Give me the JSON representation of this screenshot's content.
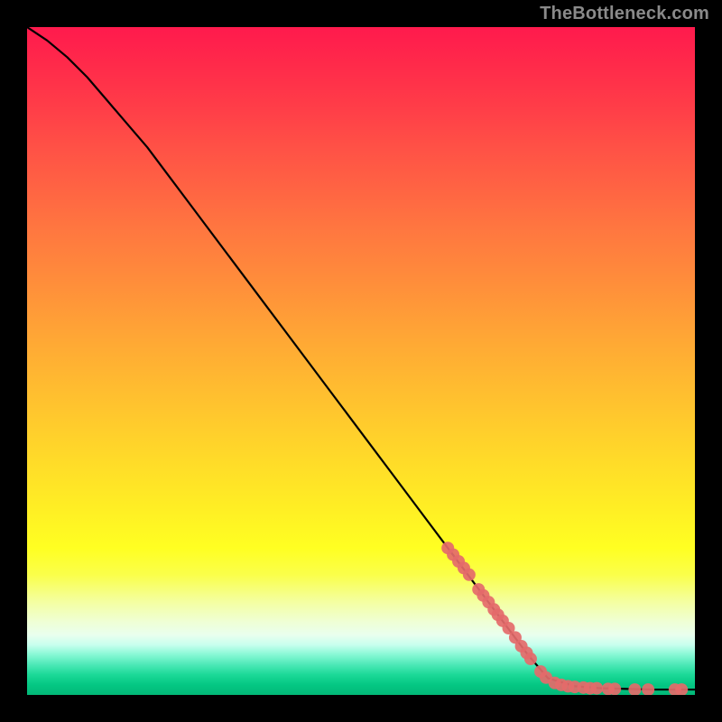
{
  "watermark": "TheBottleneck.com",
  "chart_data": {
    "type": "line",
    "title": "",
    "xlabel": "",
    "ylabel": "",
    "xlim": [
      0,
      100
    ],
    "ylim": [
      0,
      100
    ],
    "grid": false,
    "legend": false,
    "curve": {
      "name": "bottleneck-curve",
      "color": "#000000",
      "x": [
        0,
        3,
        6,
        9,
        12,
        15,
        18,
        21,
        24,
        27,
        30,
        33,
        36,
        39,
        42,
        45,
        48,
        51,
        54,
        57,
        60,
        63,
        66,
        69,
        72,
        75,
        78,
        82,
        86,
        90,
        94,
        98,
        100
      ],
      "y": [
        100,
        98,
        95.5,
        92.5,
        89,
        85.5,
        82,
        78,
        74,
        70,
        66,
        62,
        58,
        54,
        50,
        46,
        42,
        38,
        34,
        30,
        26,
        22,
        18,
        14,
        10,
        6,
        2.5,
        1.3,
        1.0,
        0.9,
        0.8,
        0.8,
        0.8
      ]
    },
    "markers": {
      "name": "highlighted-points",
      "color": "#e46a6a",
      "radius_px": 7,
      "points": [
        {
          "x": 63.0,
          "y": 22.0
        },
        {
          "x": 63.8,
          "y": 21.0
        },
        {
          "x": 64.6,
          "y": 20.0
        },
        {
          "x": 65.4,
          "y": 19.0
        },
        {
          "x": 66.2,
          "y": 18.0
        },
        {
          "x": 67.6,
          "y": 15.8
        },
        {
          "x": 68.3,
          "y": 14.9
        },
        {
          "x": 69.1,
          "y": 13.9
        },
        {
          "x": 69.9,
          "y": 12.8
        },
        {
          "x": 70.5,
          "y": 12.0
        },
        {
          "x": 71.2,
          "y": 11.1
        },
        {
          "x": 72.1,
          "y": 10.0
        },
        {
          "x": 73.1,
          "y": 8.6
        },
        {
          "x": 74.0,
          "y": 7.3
        },
        {
          "x": 74.8,
          "y": 6.3
        },
        {
          "x": 75.4,
          "y": 5.4
        },
        {
          "x": 76.9,
          "y": 3.5
        },
        {
          "x": 77.7,
          "y": 2.6
        },
        {
          "x": 79.0,
          "y": 1.8
        },
        {
          "x": 80.0,
          "y": 1.5
        },
        {
          "x": 81.0,
          "y": 1.3
        },
        {
          "x": 82.0,
          "y": 1.2
        },
        {
          "x": 83.3,
          "y": 1.1
        },
        {
          "x": 84.3,
          "y": 1.0
        },
        {
          "x": 85.3,
          "y": 1.0
        },
        {
          "x": 87.0,
          "y": 0.9
        },
        {
          "x": 88.0,
          "y": 0.9
        },
        {
          "x": 91.0,
          "y": 0.8
        },
        {
          "x": 93.0,
          "y": 0.8
        },
        {
          "x": 97.0,
          "y": 0.8
        },
        {
          "x": 98.0,
          "y": 0.8
        }
      ]
    }
  }
}
